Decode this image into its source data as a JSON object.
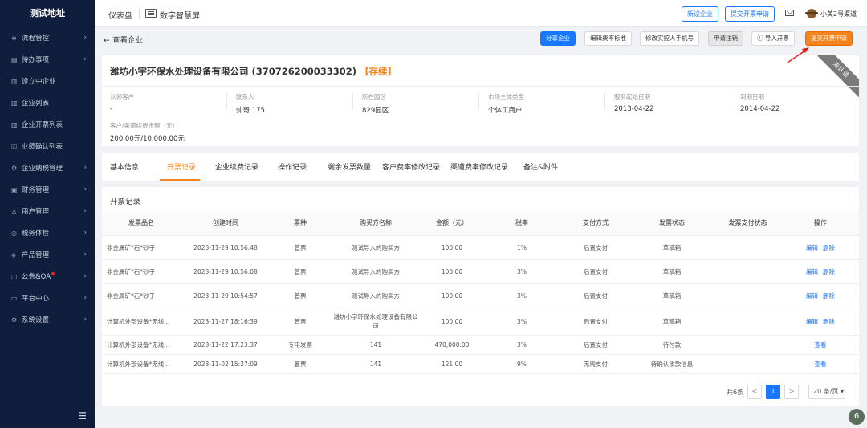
{
  "sidebar": {
    "brand": "测试地址",
    "items": [
      {
        "icon": "≡",
        "label": "流程管控",
        "arrow": true
      },
      {
        "icon": "▤",
        "label": "待办事项",
        "arrow": true
      },
      {
        "icon": "▥",
        "label": "设立中企业",
        "arrow": false
      },
      {
        "icon": "▥",
        "label": "企业列表",
        "arrow": false
      },
      {
        "icon": "▥",
        "label": "企业开票列表",
        "arrow": false
      },
      {
        "icon": "☑",
        "label": "业绩确认列表",
        "arrow": false
      },
      {
        "icon": "⚙",
        "label": "企业纳税管理",
        "arrow": true
      },
      {
        "icon": "▣",
        "label": "财务管理",
        "arrow": true
      },
      {
        "icon": "♙",
        "label": "用户管理",
        "arrow": true
      },
      {
        "icon": "◎",
        "label": "税务体检",
        "arrow": true
      },
      {
        "icon": "◈",
        "label": "产品管理",
        "arrow": true
      },
      {
        "icon": "▢",
        "label": "公告&QA",
        "arrow": true,
        "dot": true
      },
      {
        "icon": "▭",
        "label": "平台中心",
        "arrow": true
      },
      {
        "icon": "⚙",
        "label": "系统设置",
        "arrow": true
      }
    ],
    "collapse_icon": "☰"
  },
  "topbar": {
    "tab_dashboard": "仪表盘",
    "tab_screen": "数字智慧屏",
    "new_company": "新设企业",
    "submit_invoice": "提交开票申请",
    "username": "小美2号渠道"
  },
  "subbar": {
    "back": "← 查看企业",
    "actions": {
      "share": "分享企业",
      "edit_rate": "编辑费率标准",
      "edit_phone": "修改实控人手机号",
      "apply_cancel": "申请注销",
      "import_invoice": "导入开票",
      "submit_invoice": "提交开票申请"
    }
  },
  "company": {
    "name": "潍坊小宇环保水处理设备有限公司 (370726200033302)",
    "status": "【存续】",
    "ribbon": "未认领",
    "fields": [
      {
        "label": "认领客户",
        "value": "-"
      },
      {
        "label": "联系人",
        "value": "帅哥 175"
      },
      {
        "label": "所在园区",
        "value": "829园区"
      },
      {
        "label": "市场主体类型",
        "value": "个体工商户"
      },
      {
        "label": "服务起始日期",
        "value": "2013-04-22"
      },
      {
        "label": "到期日期",
        "value": "2014-04-22"
      }
    ],
    "amount_label": "客户/渠道续费金额（元）",
    "amount_value": "200.00元/10,000.00元"
  },
  "tabs": [
    "基本信息",
    "开票记录",
    "企业续费记录",
    "操作记录",
    "剩余发票数量",
    "客户费率修改记录",
    "渠道费率修改记录",
    "备注&附件"
  ],
  "active_tab": 1,
  "records": {
    "title": "开票记录",
    "columns": [
      "发票品名",
      "创建时间",
      "票种",
      "购买方名称",
      "金额（元）",
      "税率",
      "支付方式",
      "发票状态",
      "发票支付状态",
      "操作"
    ],
    "rows": [
      {
        "item": "非金属矿*石*砂子",
        "time": "2023-11-29 10:56:48",
        "type": "普票",
        "buyer": "测试导入的购买方",
        "amount": "100.00",
        "rate": "1%",
        "pay": "后置支付",
        "status": "草稿箱",
        "pay_status": "",
        "ops": [
          "编辑",
          "删除"
        ]
      },
      {
        "item": "非金属矿*石*砂子",
        "time": "2023-11-29 10:56:08",
        "type": "普票",
        "buyer": "测试导入的购买方",
        "amount": "100.00",
        "rate": "3%",
        "pay": "后置支付",
        "status": "草稿箱",
        "pay_status": "",
        "ops": [
          "编辑",
          "删除"
        ]
      },
      {
        "item": "非金属矿*石*砂子",
        "time": "2023-11-29 10:54:57",
        "type": "普票",
        "buyer": "测试导入的购买方",
        "amount": "100.00",
        "rate": "3%",
        "pay": "后置支付",
        "status": "草稿箱",
        "pay_status": "",
        "ops": [
          "编辑",
          "删除"
        ]
      },
      {
        "item": "计算机外部设备*无线...",
        "time": "2023-11-27 18:16:39",
        "type": "普票",
        "buyer": "潍坊小宇环保水处理设备有限公司",
        "amount": "100.00",
        "rate": "3%",
        "pay": "后置支付",
        "status": "草稿箱",
        "pay_status": "",
        "ops": [
          "编辑",
          "删除"
        ]
      },
      {
        "item": "计算机外部设备*无线...",
        "time": "2023-11-22 17:23:37",
        "type": "专用发票",
        "buyer": "141",
        "amount": "470,000.00",
        "rate": "3%",
        "pay": "后置支付",
        "status": "待付款",
        "pay_status": "",
        "ops": [
          "查看"
        ]
      },
      {
        "item": "计算机外部设备*无线...",
        "time": "2023-11-02 15:27:09",
        "type": "普票",
        "buyer": "141",
        "amount": "121.00",
        "rate": "9%",
        "pay": "无需支付",
        "status": "待确认收款信息",
        "pay_status": "",
        "ops": [
          "查看"
        ]
      }
    ],
    "pager": {
      "total": "共6条",
      "prev": "<",
      "page": "1",
      "next": ">",
      "size": "20 条/页 ▾"
    }
  },
  "corner_badge": "6",
  "colors": {
    "sidebar": "#0f1e3c",
    "primary": "#1677ff",
    "accent": "#f5841f"
  }
}
